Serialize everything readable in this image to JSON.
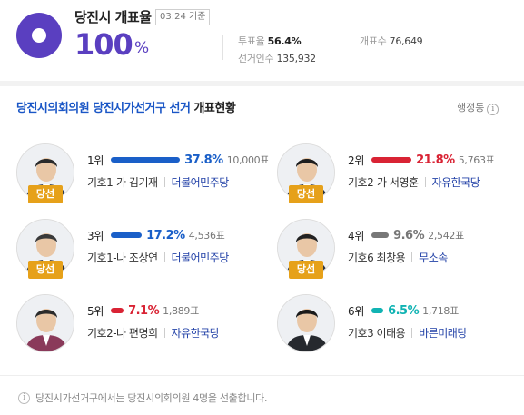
{
  "header": {
    "region_title": "당진시 개표율",
    "time_badge": "03:24 기준",
    "count_rate": "100",
    "count_unit": "%",
    "turnout_label": "투표율",
    "turnout_value": "56.4%",
    "counted_label": "개표수",
    "counted_value": "76,649",
    "electorate_label": "선거인수",
    "electorate_value": "135,932"
  },
  "section": {
    "title_blue": "당진시의회의원 당진시가선거구 선거",
    "title_dark": "개표현황",
    "side_link": "행정동",
    "side_icon": "info-icon"
  },
  "colors": {
    "accent": "#5a3fc0",
    "minjoo": "#1a5fc8",
    "jayu": "#d92334",
    "independent": "#777777",
    "bareun": "#11b3b3",
    "elected_badge": "#e6a11a"
  },
  "candidates": [
    {
      "rank": "1위",
      "pct": "37.8%",
      "pct_value": 37.8,
      "votes": "10,000표",
      "number_name": "기호1-가 김기재",
      "party": "더불어민주당",
      "elected": "당선",
      "color": "#1a5fc8"
    },
    {
      "rank": "2위",
      "pct": "21.8%",
      "pct_value": 21.8,
      "votes": "5,763표",
      "number_name": "기호2-가 서영훈",
      "party": "자유한국당",
      "elected": "당선",
      "color": "#d92334"
    },
    {
      "rank": "3위",
      "pct": "17.2%",
      "pct_value": 17.2,
      "votes": "4,536표",
      "number_name": "기호1-나 조상연",
      "party": "더불어민주당",
      "elected": "당선",
      "color": "#1a5fc8"
    },
    {
      "rank": "4위",
      "pct": "9.6%",
      "pct_value": 9.6,
      "votes": "2,542표",
      "number_name": "기호6 최창용",
      "party": "무소속",
      "elected": "당선",
      "color": "#777777"
    },
    {
      "rank": "5위",
      "pct": "7.1%",
      "pct_value": 7.1,
      "votes": "1,889표",
      "number_name": "기호2-나 편명희",
      "party": "자유한국당",
      "elected": "",
      "color": "#d92334"
    },
    {
      "rank": "6위",
      "pct": "6.5%",
      "pct_value": 6.5,
      "votes": "1,718표",
      "number_name": "기호3 이태용",
      "party": "바른미래당",
      "elected": "",
      "color": "#11b3b3"
    }
  ],
  "footer": {
    "icon": "info-icon",
    "note": "당진시가선거구에서는 당진시의회의원 4명을 선출합니다."
  }
}
